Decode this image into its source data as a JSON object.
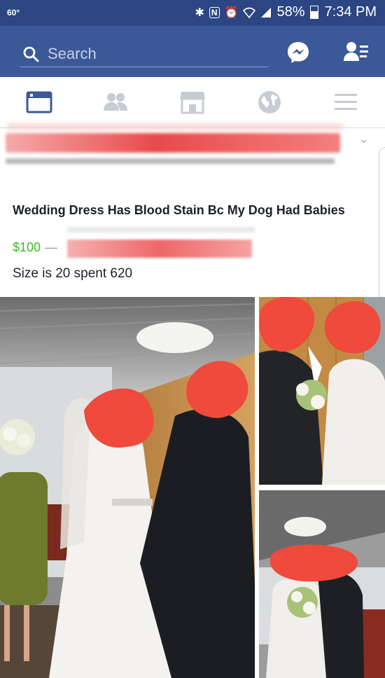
{
  "status_bar": {
    "temperature": "60°",
    "battery_percent": "58%",
    "time": "7:34 PM",
    "icons": [
      "bluetooth-icon",
      "nfc-icon",
      "alarm-icon",
      "wifi-icon",
      "signal-icon",
      "battery-icon"
    ]
  },
  "nav_bar": {
    "search_placeholder": "Search",
    "icons": [
      "search-icon",
      "messenger-icon",
      "friend-requests-icon"
    ]
  },
  "tab_bar": {
    "tabs": [
      {
        "name": "news-feed",
        "icon": "news-feed-icon",
        "active": true
      },
      {
        "name": "friends",
        "icon": "friends-icon",
        "active": false
      },
      {
        "name": "marketplace",
        "icon": "marketplace-icon",
        "active": false
      },
      {
        "name": "notifications",
        "icon": "globe-icon",
        "active": false
      },
      {
        "name": "menu",
        "icon": "hamburger-menu-icon",
        "active": false
      }
    ]
  },
  "post": {
    "title": "Wedding Dress Has Blood Stain Bc My Dog Had Babies",
    "price": "$100",
    "separator": "—",
    "description": "Size is 20 spent 620"
  },
  "colors": {
    "status_bar": "#2c4683",
    "nav_bar": "#3b5998",
    "active_tab": "#3b5998",
    "inactive_tab": "#c7cbd3",
    "price": "#42b72a",
    "redaction": "#e84a4a"
  }
}
